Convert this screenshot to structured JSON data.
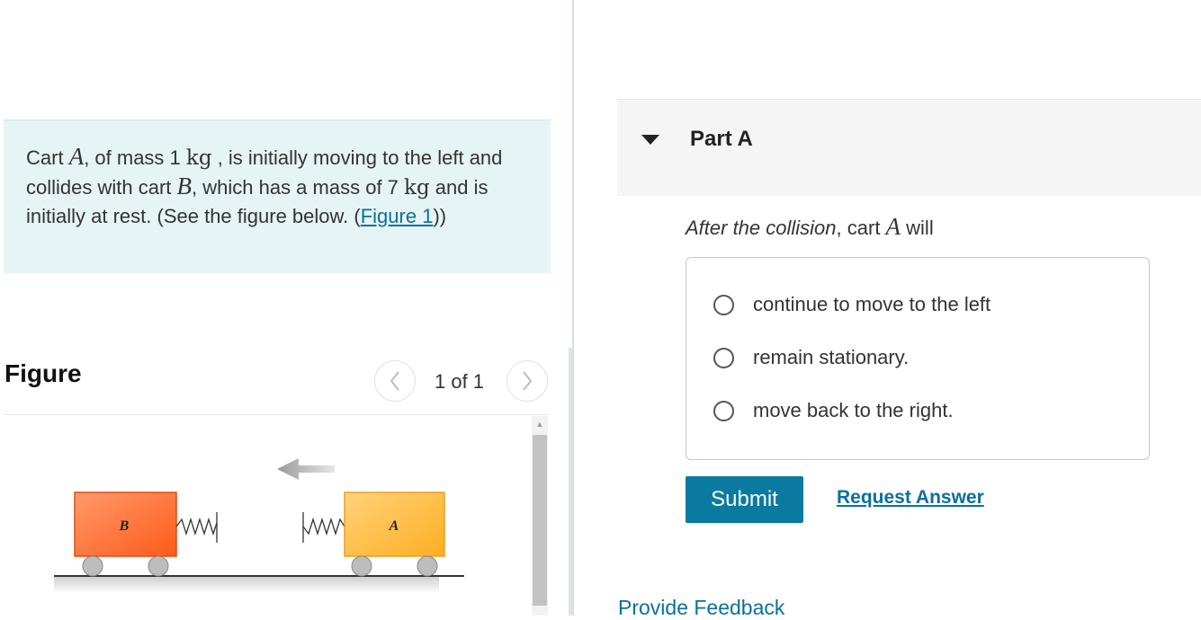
{
  "problem": {
    "text_1": "Cart ",
    "cart_a": "A",
    "text_2": ", of mass 1 ",
    "unit_1": "kg",
    "text_3": " , is initially moving to the left and collides with cart ",
    "cart_b": "B",
    "text_4": ", which has a mass of 7 ",
    "unit_2": "kg",
    "text_5": " and is initially at rest. (See the figure below. (",
    "figure_link": "Figure 1",
    "text_6": "))"
  },
  "figure": {
    "title": "Figure",
    "counter": "1 of 1",
    "prev_icon": "chevron-left-icon",
    "next_icon": "chevron-right-icon",
    "cart_b_label": "B",
    "cart_a_label": "A",
    "colors": {
      "cart_b": "#ff6a2a",
      "cart_a": "#ffb534"
    }
  },
  "part": {
    "title": "Part A",
    "toggle_icon": "caret-down-icon"
  },
  "question": {
    "italic_part": "After the collision",
    "text_1": ", cart ",
    "cart": "A",
    "text_2": " will"
  },
  "options": [
    {
      "label": "continue to move to the left",
      "selected": false
    },
    {
      "label": "remain stationary.",
      "selected": false
    },
    {
      "label": "move back to the right.",
      "selected": false
    }
  ],
  "actions": {
    "submit": "Submit",
    "request_answer": "Request Answer"
  },
  "footer": {
    "feedback": "Provide Feedback"
  },
  "colors": {
    "accent": "#0b7aa0",
    "link": "#0b6f9d",
    "problem_bg": "#e6f4f5"
  }
}
